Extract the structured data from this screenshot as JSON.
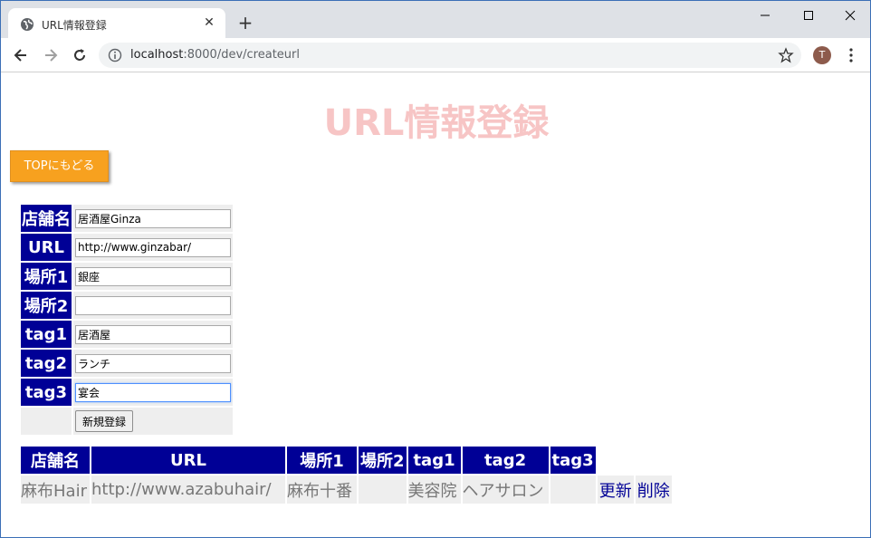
{
  "browser": {
    "tab_title": "URL情報登録",
    "close_glyph": "✕",
    "new_tab_glyph": "+",
    "url_host": "localhost",
    "url_path": ":8000/dev/createurl",
    "avatar_initial": "T"
  },
  "page": {
    "title": "URL情報登録",
    "top_button": "TOPにもどる"
  },
  "form": {
    "labels": [
      "店舗名",
      "URL",
      "場所1",
      "場所2",
      "tag1",
      "tag2",
      "tag3"
    ],
    "values": [
      "居酒屋Ginza",
      "http://www.ginzabar/",
      "銀座",
      "",
      "居酒屋",
      "ランチ",
      "宴会"
    ],
    "submit_label": "新規登録"
  },
  "list": {
    "headers": [
      "店舗名",
      "URL",
      "場所1",
      "場所2",
      "tag1",
      "tag2",
      "tag3"
    ],
    "rows": [
      {
        "cells": [
          "麻布Hair",
          "http://www.azabuhair/",
          "麻布十番",
          "",
          "美容院",
          "ヘアサロン",
          ""
        ],
        "update_label": "更新",
        "delete_label": "削除"
      }
    ]
  }
}
